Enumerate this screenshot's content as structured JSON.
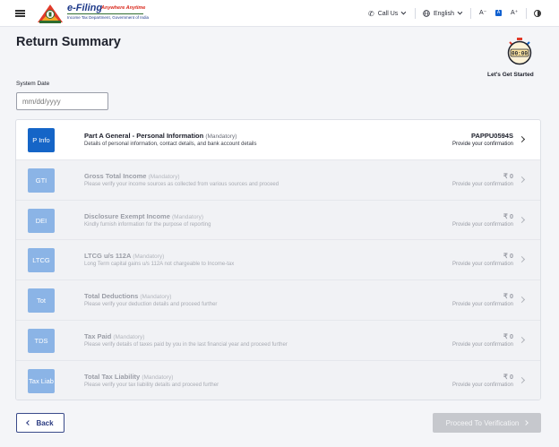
{
  "header": {
    "logo_title": "e-Filing",
    "logo_tagline": "Anywhere Anytime",
    "logo_subtitle": "Income Tax Department, Government of India",
    "call_us": "Call Us",
    "language": "English",
    "font_decrease": "A⁻",
    "font_normal": "A",
    "font_increase": "A⁺",
    "icons": [
      "menu-icon",
      "emblem-logo",
      "phone-icon",
      "globe-icon",
      "contrast-icon"
    ]
  },
  "page": {
    "title": "Return Summary",
    "timer_display": "00:00",
    "timer_label": "Let's Get Started"
  },
  "date": {
    "label": "System Date",
    "placeholder": "mm/dd/yyyy"
  },
  "sections": [
    {
      "icon_label": "P Info",
      "title": "Part A General - Personal Information",
      "tag": "(Mandatory)",
      "description": "Details of personal information, contact details, and bank account details",
      "value": "PAPPU0594S",
      "status": "Provide your confirmation",
      "enabled": true
    },
    {
      "icon_label": "GTI",
      "title": "Gross Total Income",
      "tag": "(Mandatory)",
      "description": "Please verify your income sources as collected from various sources and proceed",
      "value": "₹ 0",
      "status": "Provide your confirmation",
      "enabled": false
    },
    {
      "icon_label": "DEI",
      "title": "Disclosure Exempt Income",
      "tag": "(Mandatory)",
      "description": "Kindly furnish information for the purpose of reporting",
      "value": "₹ 0",
      "status": "Provide your confirmation",
      "enabled": false
    },
    {
      "icon_label": "LTCG",
      "title": "LTCG u/s 112A",
      "tag": "(Mandatory)",
      "description": "Long Term capital gains u/s 112A not chargeable to Income-tax",
      "value": "₹ 0",
      "status": "Provide your confirmation",
      "enabled": false
    },
    {
      "icon_label": "Tot",
      "title": "Total Deductions",
      "tag": "(Mandatory)",
      "description": "Please verify your deduction details and proceed further",
      "value": "₹ 0",
      "status": "Provide your confirmation",
      "enabled": false
    },
    {
      "icon_label": "TDS",
      "title": "Tax Paid",
      "tag": "(Mandatory)",
      "description": "Please verify details of taxes paid by you in the last financial year and proceed further",
      "value": "₹ 0",
      "status": "Provide your confirmation",
      "enabled": false
    },
    {
      "icon_label": "Tax Liab",
      "title": "Total Tax Liability",
      "tag": "(Mandatory)",
      "description": "Please verify your tax liability details and proceed further",
      "value": "₹ 0",
      "status": "Provide your confirmation",
      "enabled": false
    }
  ],
  "footer": {
    "back_label": "Back",
    "proceed_label": "Proceed To Verification"
  },
  "colors": {
    "brand_blue": "#1565c7",
    "icon_disabled": "#8bb4e6",
    "proceed_disabled": "#c6c8cd",
    "back_border": "#3a4a8a"
  }
}
